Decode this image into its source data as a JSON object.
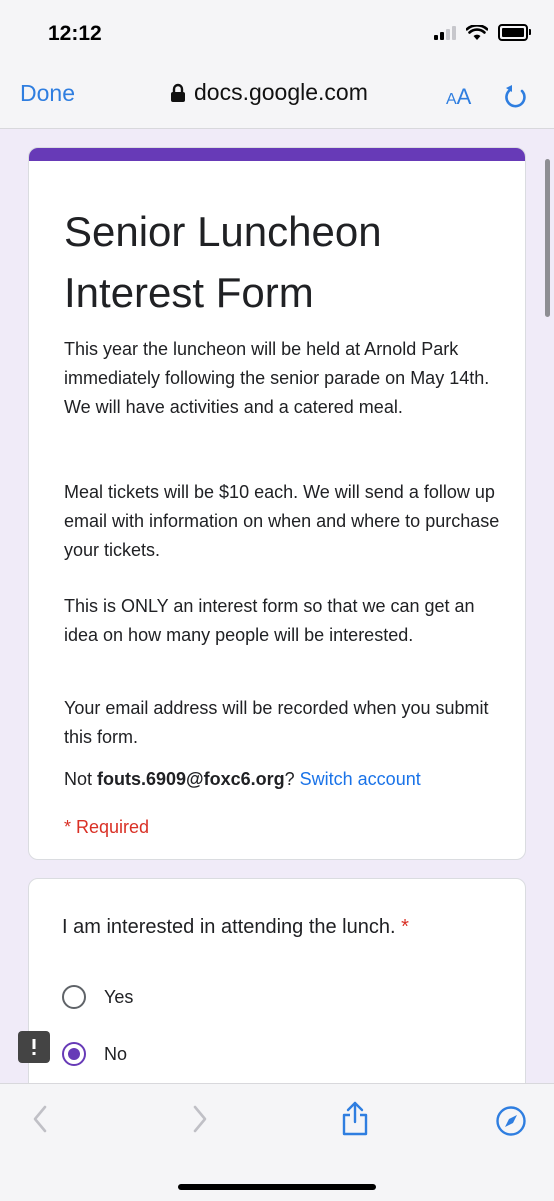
{
  "status_bar": {
    "time": "12:12"
  },
  "browser": {
    "done_label": "Done",
    "url": "docs.google.com",
    "text_size_label_small": "A",
    "text_size_label_big": "A"
  },
  "form": {
    "title": "Senior Luncheon Interest Form",
    "description": [
      "This year the luncheon will be held at Arnold Park immediately following the senior parade on May 14th. We will have activities and a catered meal.",
      "Meal tickets will be $10 each. We will send a follow up email with information on when and where to purchase your tickets.",
      "This is ONLY an interest form so that we can get an idea on how many people will be interested."
    ],
    "email_notice": "Your email address will be recorded when you submit this form.",
    "account_prefix": "Not ",
    "account_email": "fouts.6909@foxc6.org",
    "account_suffix": "?",
    "switch_account_label": "Switch account",
    "required_note": "* Required",
    "question": {
      "text": "I am interested in attending the lunch.",
      "required_marker": "*",
      "options": [
        {
          "label": "Yes",
          "selected": false
        },
        {
          "label": "No",
          "selected": true
        }
      ]
    }
  },
  "colors": {
    "accent": "#673ab7",
    "link": "#1a73e8",
    "required": "#d93025",
    "ios_blue": "#2f7ee0",
    "page_bg": "#f0ebf8"
  }
}
